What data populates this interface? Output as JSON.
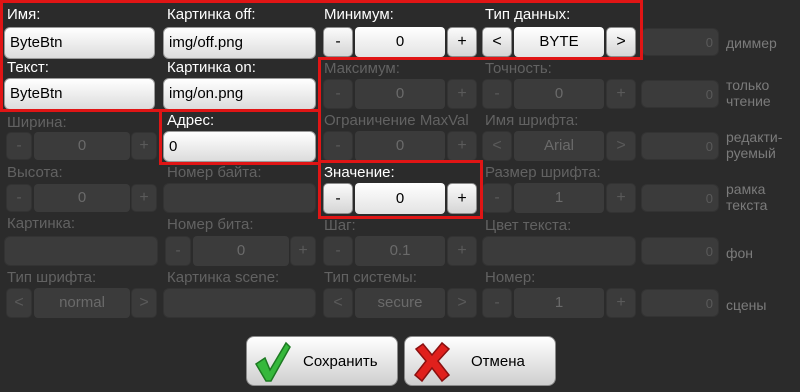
{
  "form": {
    "name": {
      "label": "Имя:",
      "value": "ByteBtn"
    },
    "text": {
      "label": "Текст:",
      "value": "ByteBtn"
    },
    "width": {
      "label": "Ширина:",
      "value": "0"
    },
    "height": {
      "label": "Высота:",
      "value": "0"
    },
    "picture": {
      "label": "Картинка:",
      "value": ""
    },
    "font_type": {
      "label": "Тип шрифта:",
      "value": "normal"
    },
    "picture_off": {
      "label": "Картинка off:",
      "value": "img/off.png"
    },
    "picture_on": {
      "label": "Картинка on:",
      "value": "img/on.png"
    },
    "address": {
      "label": "Адрес:",
      "value": "0"
    },
    "byte_number": {
      "label": "Номер байта:",
      "value": ""
    },
    "bit_number": {
      "label": "Номер бита:",
      "value": "0"
    },
    "picture_scene": {
      "label": "Картинка scene:",
      "value": ""
    },
    "minimum": {
      "label": "Минимум:",
      "value": "0"
    },
    "maximum": {
      "label": "Максимум:",
      "value": "0"
    },
    "max_limit": {
      "label": "Ограничение MaxVal",
      "value": "0"
    },
    "value": {
      "label": "Значение:",
      "value": "0"
    },
    "step": {
      "label": "Шаг:",
      "value": "0.1"
    },
    "system_type": {
      "label": "Тип системы:",
      "value": "secure"
    },
    "data_type": {
      "label": "Тип данных:",
      "value": "BYTE"
    },
    "precision": {
      "label": "Точность:",
      "value": "0"
    },
    "font_name": {
      "label": "Имя шрифта:",
      "value": "Arial"
    },
    "font_size": {
      "label": "Размер шрифта:",
      "value": "1"
    },
    "text_color": {
      "label": "Цвет текста:",
      "value": ""
    },
    "number": {
      "label": "Номер:",
      "value": "1"
    }
  },
  "symbols": {
    "minus": "-",
    "plus": "+",
    "prev": "<",
    "next": ">"
  },
  "toggles": [
    {
      "label1": "диммер",
      "label2": "",
      "value": "0"
    },
    {
      "label1": "только",
      "label2": "чтение",
      "value": "0"
    },
    {
      "label1": "редакти-",
      "label2": "руемый",
      "value": "0"
    },
    {
      "label1": "рамка",
      "label2": "текста",
      "value": "0"
    },
    {
      "label1": "фон",
      "label2": "",
      "value": "0"
    },
    {
      "label1": "сцены",
      "label2": "",
      "value": "0"
    }
  ],
  "buttons": {
    "save": "Сохранить",
    "cancel": "Отмена"
  },
  "colors": {
    "highlight": "#e01515",
    "save_icon": "#36b83c",
    "cancel_icon": "#e0201c"
  }
}
